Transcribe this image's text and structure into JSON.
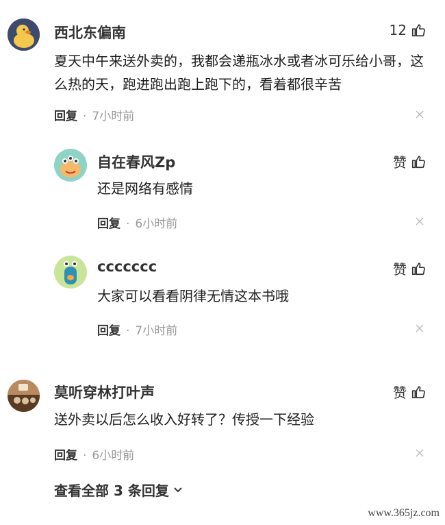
{
  "comments": [
    {
      "user": "西北东偏南",
      "likes": "12",
      "text": "夏天中午来送外卖的，我都会递瓶冰水或者冰可乐给小哥，这么热的天，跑进跑出跑上跑下的，看着都很辛苦",
      "reply_label": "回复",
      "time": "7小时前"
    },
    {
      "user": "自在春风Zp",
      "likes": "赞",
      "text": "还是网络有感情",
      "reply_label": "回复",
      "time": "6小时前"
    },
    {
      "user": "ccccccc",
      "likes": "赞",
      "text": "大家可以看看阴律无情这本书哦",
      "reply_label": "回复",
      "time": "7小时前"
    },
    {
      "user": "莫听穿林打叶声",
      "likes": "赞",
      "text": "送外卖以后怎么收入好转了？传授一下经验",
      "reply_label": "回复",
      "time": "6小时前"
    }
  ],
  "more_replies": "查看全部 3 条回复",
  "watermark": "www.365jz.com"
}
